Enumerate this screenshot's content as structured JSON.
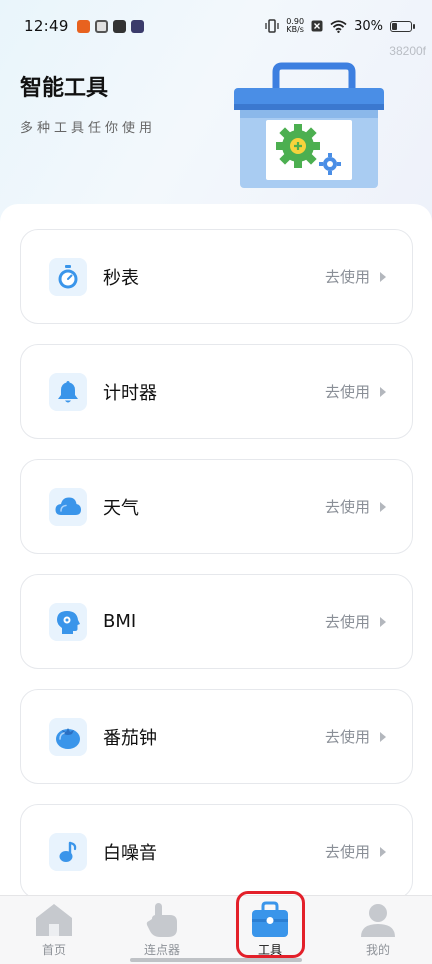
{
  "status_bar": {
    "time": "12:49",
    "net_speed_value": "0.90",
    "net_speed_unit": "KB/s",
    "battery_percent": "30%",
    "battery_level": 0.3
  },
  "build_tag": "38200f",
  "header": {
    "title": "智能工具",
    "subtitle": "多种工具任你使用"
  },
  "tools": [
    {
      "name": "秒表",
      "action": "去使用",
      "icon": "stopwatch-icon"
    },
    {
      "name": "计时器",
      "action": "去使用",
      "icon": "bell-icon"
    },
    {
      "name": "天气",
      "action": "去使用",
      "icon": "cloud-icon"
    },
    {
      "name": "BMI",
      "action": "去使用",
      "icon": "head-profile-icon"
    },
    {
      "name": "番茄钟",
      "action": "去使用",
      "icon": "tomato-icon"
    },
    {
      "name": "白噪音",
      "action": "去使用",
      "icon": "music-note-icon"
    }
  ],
  "tab_bar": {
    "tabs": [
      {
        "label": "首页",
        "icon": "home-icon",
        "active": false
      },
      {
        "label": "连点器",
        "icon": "tap-hand-icon",
        "active": false
      },
      {
        "label": "工具",
        "icon": "toolbox-icon",
        "active": true
      },
      {
        "label": "我的",
        "icon": "user-icon",
        "active": false
      }
    ]
  },
  "colors": {
    "accent": "#3a95ea",
    "tool_icon_bg": "#e8f3fd",
    "active_outline": "#e3202a",
    "inactive_tab_icon": "#c6c9ce"
  }
}
